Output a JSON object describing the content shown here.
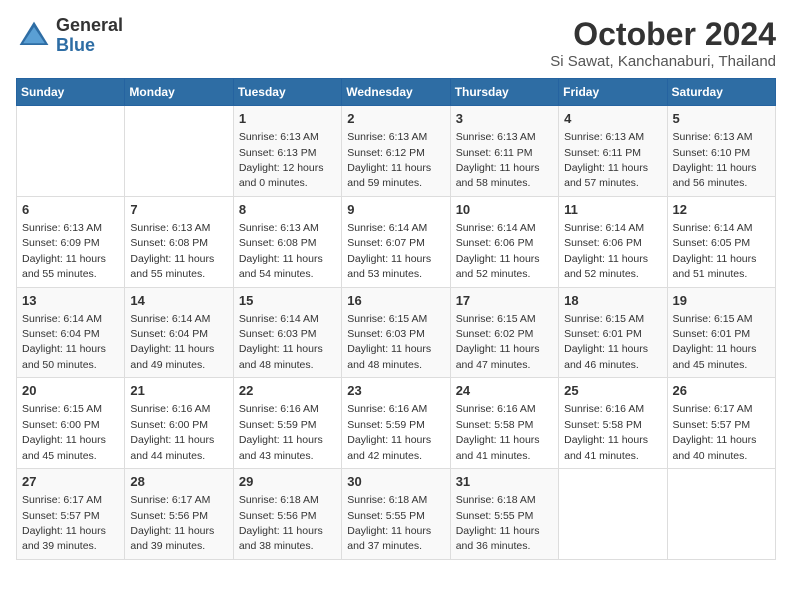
{
  "header": {
    "logo_general": "General",
    "logo_blue": "Blue",
    "title": "October 2024",
    "subtitle": "Si Sawat, Kanchanaburi, Thailand"
  },
  "days_of_week": [
    "Sunday",
    "Monday",
    "Tuesday",
    "Wednesday",
    "Thursday",
    "Friday",
    "Saturday"
  ],
  "weeks": [
    [
      {
        "day": "",
        "detail": ""
      },
      {
        "day": "",
        "detail": ""
      },
      {
        "day": "1",
        "detail": "Sunrise: 6:13 AM\nSunset: 6:13 PM\nDaylight: 12 hours and 0 minutes."
      },
      {
        "day": "2",
        "detail": "Sunrise: 6:13 AM\nSunset: 6:12 PM\nDaylight: 11 hours and 59 minutes."
      },
      {
        "day": "3",
        "detail": "Sunrise: 6:13 AM\nSunset: 6:11 PM\nDaylight: 11 hours and 58 minutes."
      },
      {
        "day": "4",
        "detail": "Sunrise: 6:13 AM\nSunset: 6:11 PM\nDaylight: 11 hours and 57 minutes."
      },
      {
        "day": "5",
        "detail": "Sunrise: 6:13 AM\nSunset: 6:10 PM\nDaylight: 11 hours and 56 minutes."
      }
    ],
    [
      {
        "day": "6",
        "detail": "Sunrise: 6:13 AM\nSunset: 6:09 PM\nDaylight: 11 hours and 55 minutes."
      },
      {
        "day": "7",
        "detail": "Sunrise: 6:13 AM\nSunset: 6:08 PM\nDaylight: 11 hours and 55 minutes."
      },
      {
        "day": "8",
        "detail": "Sunrise: 6:13 AM\nSunset: 6:08 PM\nDaylight: 11 hours and 54 minutes."
      },
      {
        "day": "9",
        "detail": "Sunrise: 6:14 AM\nSunset: 6:07 PM\nDaylight: 11 hours and 53 minutes."
      },
      {
        "day": "10",
        "detail": "Sunrise: 6:14 AM\nSunset: 6:06 PM\nDaylight: 11 hours and 52 minutes."
      },
      {
        "day": "11",
        "detail": "Sunrise: 6:14 AM\nSunset: 6:06 PM\nDaylight: 11 hours and 52 minutes."
      },
      {
        "day": "12",
        "detail": "Sunrise: 6:14 AM\nSunset: 6:05 PM\nDaylight: 11 hours and 51 minutes."
      }
    ],
    [
      {
        "day": "13",
        "detail": "Sunrise: 6:14 AM\nSunset: 6:04 PM\nDaylight: 11 hours and 50 minutes."
      },
      {
        "day": "14",
        "detail": "Sunrise: 6:14 AM\nSunset: 6:04 PM\nDaylight: 11 hours and 49 minutes."
      },
      {
        "day": "15",
        "detail": "Sunrise: 6:14 AM\nSunset: 6:03 PM\nDaylight: 11 hours and 48 minutes."
      },
      {
        "day": "16",
        "detail": "Sunrise: 6:15 AM\nSunset: 6:03 PM\nDaylight: 11 hours and 48 minutes."
      },
      {
        "day": "17",
        "detail": "Sunrise: 6:15 AM\nSunset: 6:02 PM\nDaylight: 11 hours and 47 minutes."
      },
      {
        "day": "18",
        "detail": "Sunrise: 6:15 AM\nSunset: 6:01 PM\nDaylight: 11 hours and 46 minutes."
      },
      {
        "day": "19",
        "detail": "Sunrise: 6:15 AM\nSunset: 6:01 PM\nDaylight: 11 hours and 45 minutes."
      }
    ],
    [
      {
        "day": "20",
        "detail": "Sunrise: 6:15 AM\nSunset: 6:00 PM\nDaylight: 11 hours and 45 minutes."
      },
      {
        "day": "21",
        "detail": "Sunrise: 6:16 AM\nSunset: 6:00 PM\nDaylight: 11 hours and 44 minutes."
      },
      {
        "day": "22",
        "detail": "Sunrise: 6:16 AM\nSunset: 5:59 PM\nDaylight: 11 hours and 43 minutes."
      },
      {
        "day": "23",
        "detail": "Sunrise: 6:16 AM\nSunset: 5:59 PM\nDaylight: 11 hours and 42 minutes."
      },
      {
        "day": "24",
        "detail": "Sunrise: 6:16 AM\nSunset: 5:58 PM\nDaylight: 11 hours and 41 minutes."
      },
      {
        "day": "25",
        "detail": "Sunrise: 6:16 AM\nSunset: 5:58 PM\nDaylight: 11 hours and 41 minutes."
      },
      {
        "day": "26",
        "detail": "Sunrise: 6:17 AM\nSunset: 5:57 PM\nDaylight: 11 hours and 40 minutes."
      }
    ],
    [
      {
        "day": "27",
        "detail": "Sunrise: 6:17 AM\nSunset: 5:57 PM\nDaylight: 11 hours and 39 minutes."
      },
      {
        "day": "28",
        "detail": "Sunrise: 6:17 AM\nSunset: 5:56 PM\nDaylight: 11 hours and 39 minutes."
      },
      {
        "day": "29",
        "detail": "Sunrise: 6:18 AM\nSunset: 5:56 PM\nDaylight: 11 hours and 38 minutes."
      },
      {
        "day": "30",
        "detail": "Sunrise: 6:18 AM\nSunset: 5:55 PM\nDaylight: 11 hours and 37 minutes."
      },
      {
        "day": "31",
        "detail": "Sunrise: 6:18 AM\nSunset: 5:55 PM\nDaylight: 11 hours and 36 minutes."
      },
      {
        "day": "",
        "detail": ""
      },
      {
        "day": "",
        "detail": ""
      }
    ]
  ]
}
